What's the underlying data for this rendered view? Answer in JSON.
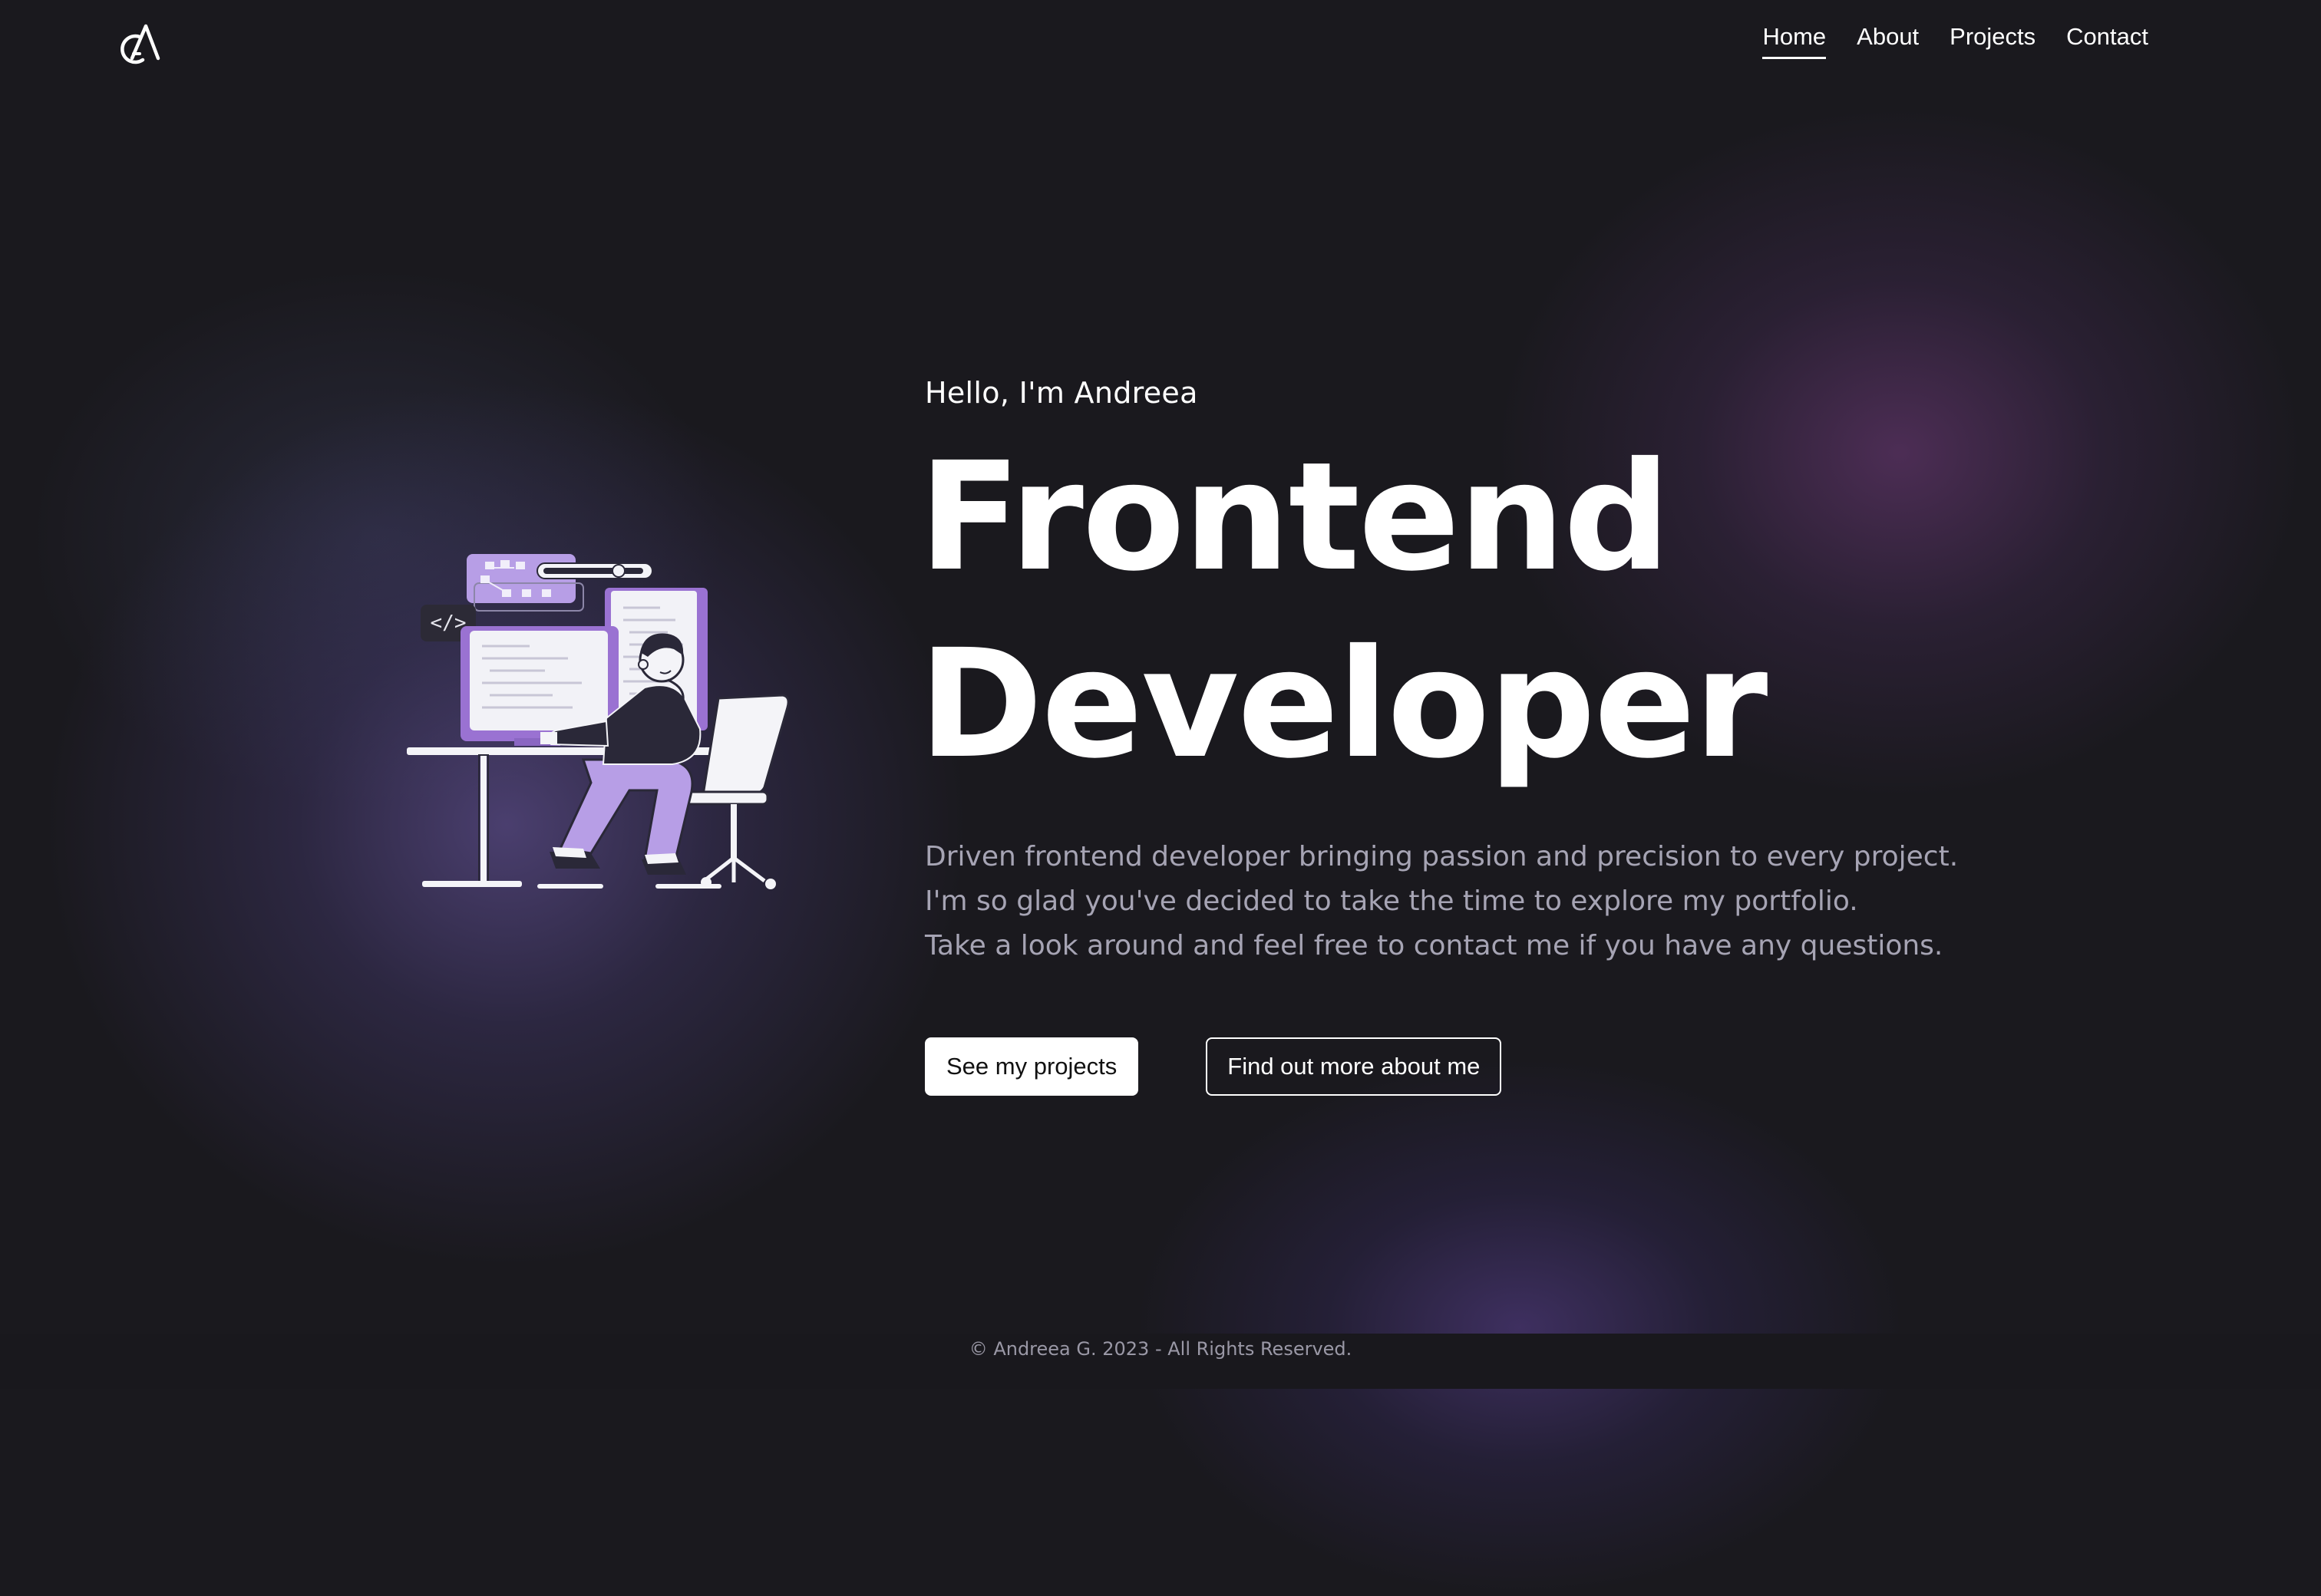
{
  "brand": {
    "logo_icon": "ga-monogram-logo"
  },
  "nav": {
    "items": [
      {
        "label": "Home",
        "active": true
      },
      {
        "label": "About",
        "active": false
      },
      {
        "label": "Projects",
        "active": false
      },
      {
        "label": "Contact",
        "active": false
      }
    ]
  },
  "hero": {
    "greeting": "Hello, I'm Andreea",
    "headline_line1": "Frontend",
    "headline_line2": "Developer",
    "intro_lines": [
      "Driven frontend developer bringing passion and precision to every project.",
      "I'm so glad you've decided to take the time to explore my portfolio.",
      "Take a look around and feel free to contact me if you have any questions."
    ],
    "primary_button": "See my projects",
    "secondary_button": "Find out more about me",
    "illustration": {
      "icon": "developer-at-desk-illustration",
      "code_badge": "</>"
    }
  },
  "footer": {
    "copyright": "© Andreea G. 2023 - All Rights Reserved."
  },
  "colors": {
    "background": "#1a191e",
    "accent_purple": "#9b7fd4",
    "text_primary": "#ffffff",
    "text_muted": "#a6a4b4"
  }
}
